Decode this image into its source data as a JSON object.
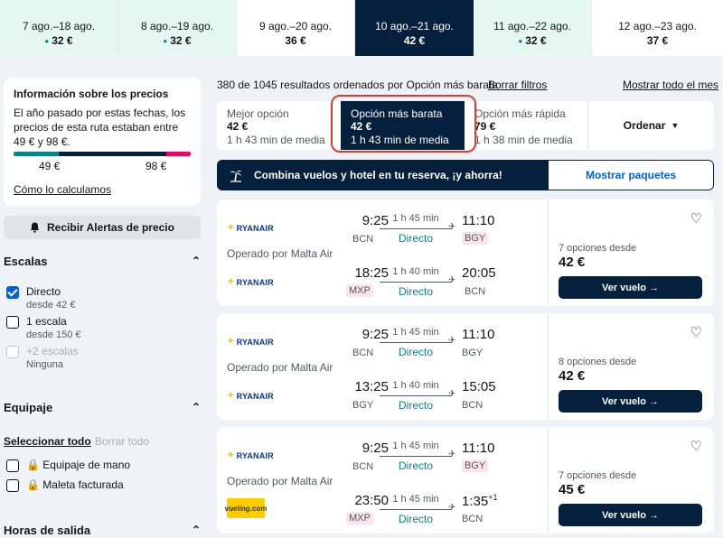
{
  "date_tabs": [
    {
      "range": "7 ago.–18 ago.",
      "price": "32 €",
      "cheap": true
    },
    {
      "range": "8 ago.–19 ago.",
      "price": "32 €",
      "cheap": true
    },
    {
      "range": "9 ago.–20 ago.",
      "price": "36 €",
      "cheap": false
    },
    {
      "range": "10 ago.–21 ago.",
      "price": "42 €",
      "cheap": false,
      "active": true
    },
    {
      "range": "11 ago.–22 ago.",
      "price": "32 €",
      "cheap": true
    },
    {
      "range": "12 ago.–23 ago.",
      "price": "37 €",
      "cheap": false
    }
  ],
  "price_info": {
    "title": "Información sobre los precios",
    "text": "El año pasado por estas fechas, los precios de esta ruta estaban entre 49 € y 98 €.",
    "low": "49 €",
    "high": "98 €",
    "link": "Cómo lo calculamos"
  },
  "alert_button": "Recibir Alertas de precio",
  "filters": {
    "stops_title": "Escalas",
    "stops": [
      {
        "label": "Directo",
        "sub": "desde 42 €",
        "checked": true
      },
      {
        "label": "1 escala",
        "sub": "desde 150 €"
      },
      {
        "label": "+2 escalas",
        "sub": "Ninguna",
        "disabled": true
      }
    ],
    "baggage_title": "Equipaje",
    "select_all": "Seleccionar todo",
    "clear_all": "Borrar todo",
    "baggage": [
      {
        "label": "Equipaje de mano"
      },
      {
        "label": "Maleta facturada"
      }
    ],
    "departure_title": "Horas de salida"
  },
  "results": {
    "count": "380 de 1045 resultados ordenados por Opción más barata",
    "clear_filters": "Borrar filtros",
    "show_month": "Mostrar todo el mes"
  },
  "sort_tabs": [
    {
      "label": "Mejor opción",
      "price": "42 €",
      "duration": "1 h 43 min de media"
    },
    {
      "label": "Opción más barata",
      "price": "42 €",
      "duration": "1 h 43 min de media",
      "active": true
    },
    {
      "label": "Opción más rápida",
      "price": "79 €",
      "duration": "1 h 38 min de media"
    }
  ],
  "sort_order": "Ordenar",
  "promo": {
    "text": "Combina vuelos y hotel en tu reserva, ¡y ahorra!",
    "button": "Mostrar paquetes"
  },
  "cards": [
    {
      "operated": "Operado por Malta Air",
      "options": "7 opciones desde",
      "price": "42 €",
      "button": "Ver vuelo →",
      "legs": [
        {
          "airline": "RYANAIR",
          "dep": "9:25",
          "from": "BCN",
          "arr": "11:10",
          "to": "BGY",
          "duration": "1 h 45 min",
          "stops": "Directo"
        },
        {
          "airline": "RYANAIR",
          "dep": "18:25",
          "from": "MXP",
          "arr": "20:05",
          "to": "BCN",
          "duration": "1 h 40 min",
          "stops": "Directo"
        }
      ]
    },
    {
      "operated": "Operado por Malta Air",
      "options": "8 opciones desde",
      "price": "42 €",
      "button": "Ver vuelo →",
      "legs": [
        {
          "airline": "RYANAIR",
          "dep": "9:25",
          "from": "BCN",
          "arr": "11:10",
          "to": "BGY",
          "duration": "1 h 45 min",
          "stops": "Directo"
        },
        {
          "airline": "RYANAIR",
          "dep": "13:25",
          "from": "BGY",
          "arr": "15:05",
          "to": "BCN",
          "duration": "1 h 40 min",
          "stops": "Directo"
        }
      ]
    },
    {
      "operated": "Operado por Malta Air",
      "options": "7 opciones desde",
      "price": "45 €",
      "button": "Ver vuelo →",
      "legs": [
        {
          "airline": "RYANAIR",
          "dep": "9:25",
          "from": "BCN",
          "arr": "11:10",
          "to": "BGY",
          "duration": "1 h 45 min",
          "stops": "Directo"
        },
        {
          "airline": "vueling.com",
          "dep": "23:50",
          "from": "MXP",
          "arr": "1:35",
          "arr_plus": "+1",
          "to": "BCN",
          "duration": "1 h 45 min",
          "stops": "Directo"
        }
      ]
    }
  ],
  "colors": {
    "navy": "#05203c",
    "teal": "#0c838a",
    "pink": "#e70866",
    "blue": "#0062e3",
    "highlight": "#e23a2a"
  }
}
